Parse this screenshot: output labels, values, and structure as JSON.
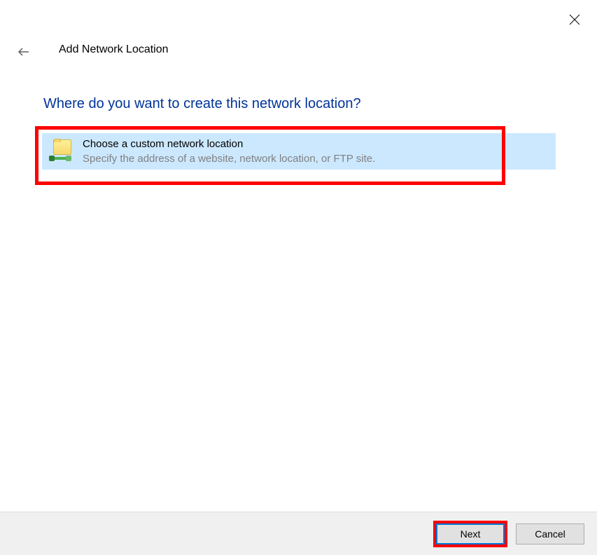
{
  "window": {
    "title": "Add Network Location",
    "heading": "Where do you want to create this network location?"
  },
  "option": {
    "title": "Choose a custom network location",
    "description": "Specify the address of a website, network location, or FTP site."
  },
  "buttons": {
    "next": "Next",
    "cancel": "Cancel"
  }
}
